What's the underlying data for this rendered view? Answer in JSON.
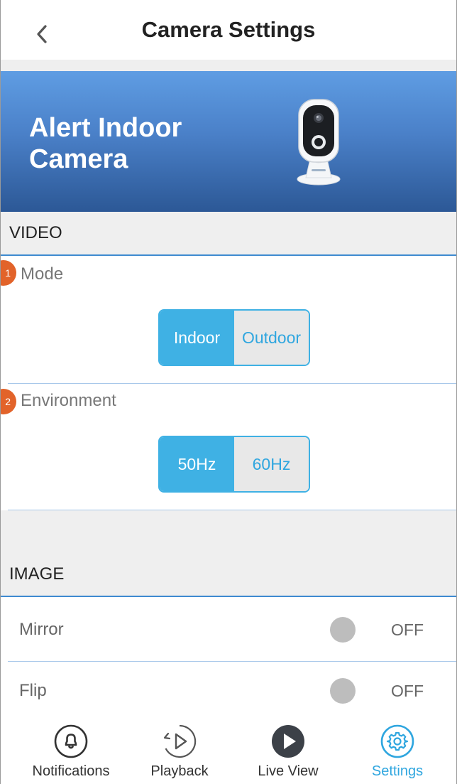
{
  "header": {
    "title": "Camera Settings",
    "back_icon": "chevron-left-icon"
  },
  "banner": {
    "line1": "Alert Indoor",
    "line2": "Camera",
    "image": "camera-device-image"
  },
  "video_section": {
    "title": "VIDEO",
    "mode": {
      "badge": "1",
      "label": "Mode",
      "options": [
        "Indoor",
        "Outdoor"
      ],
      "selected": "Indoor"
    },
    "environment": {
      "badge": "2",
      "label": "Environment",
      "options": [
        "50Hz",
        "60Hz"
      ],
      "selected": "50Hz"
    }
  },
  "image_section": {
    "title": "IMAGE",
    "rows": [
      {
        "label": "Mirror",
        "state": "OFF"
      },
      {
        "label": "Flip",
        "state": "OFF"
      }
    ]
  },
  "tabs": [
    {
      "label": "Notifications",
      "icon": "bell-icon",
      "active": false
    },
    {
      "label": "Playback",
      "icon": "playback-icon",
      "active": false
    },
    {
      "label": "Live View",
      "icon": "play-icon",
      "active": false
    },
    {
      "label": "Settings",
      "icon": "gear-icon",
      "active": true
    }
  ],
  "colors": {
    "accent": "#3fb1e4",
    "badge": "#e2632a",
    "banner_top": "#5f9de3",
    "banner_bottom": "#2c5896",
    "section_line": "#3e8ad0"
  }
}
